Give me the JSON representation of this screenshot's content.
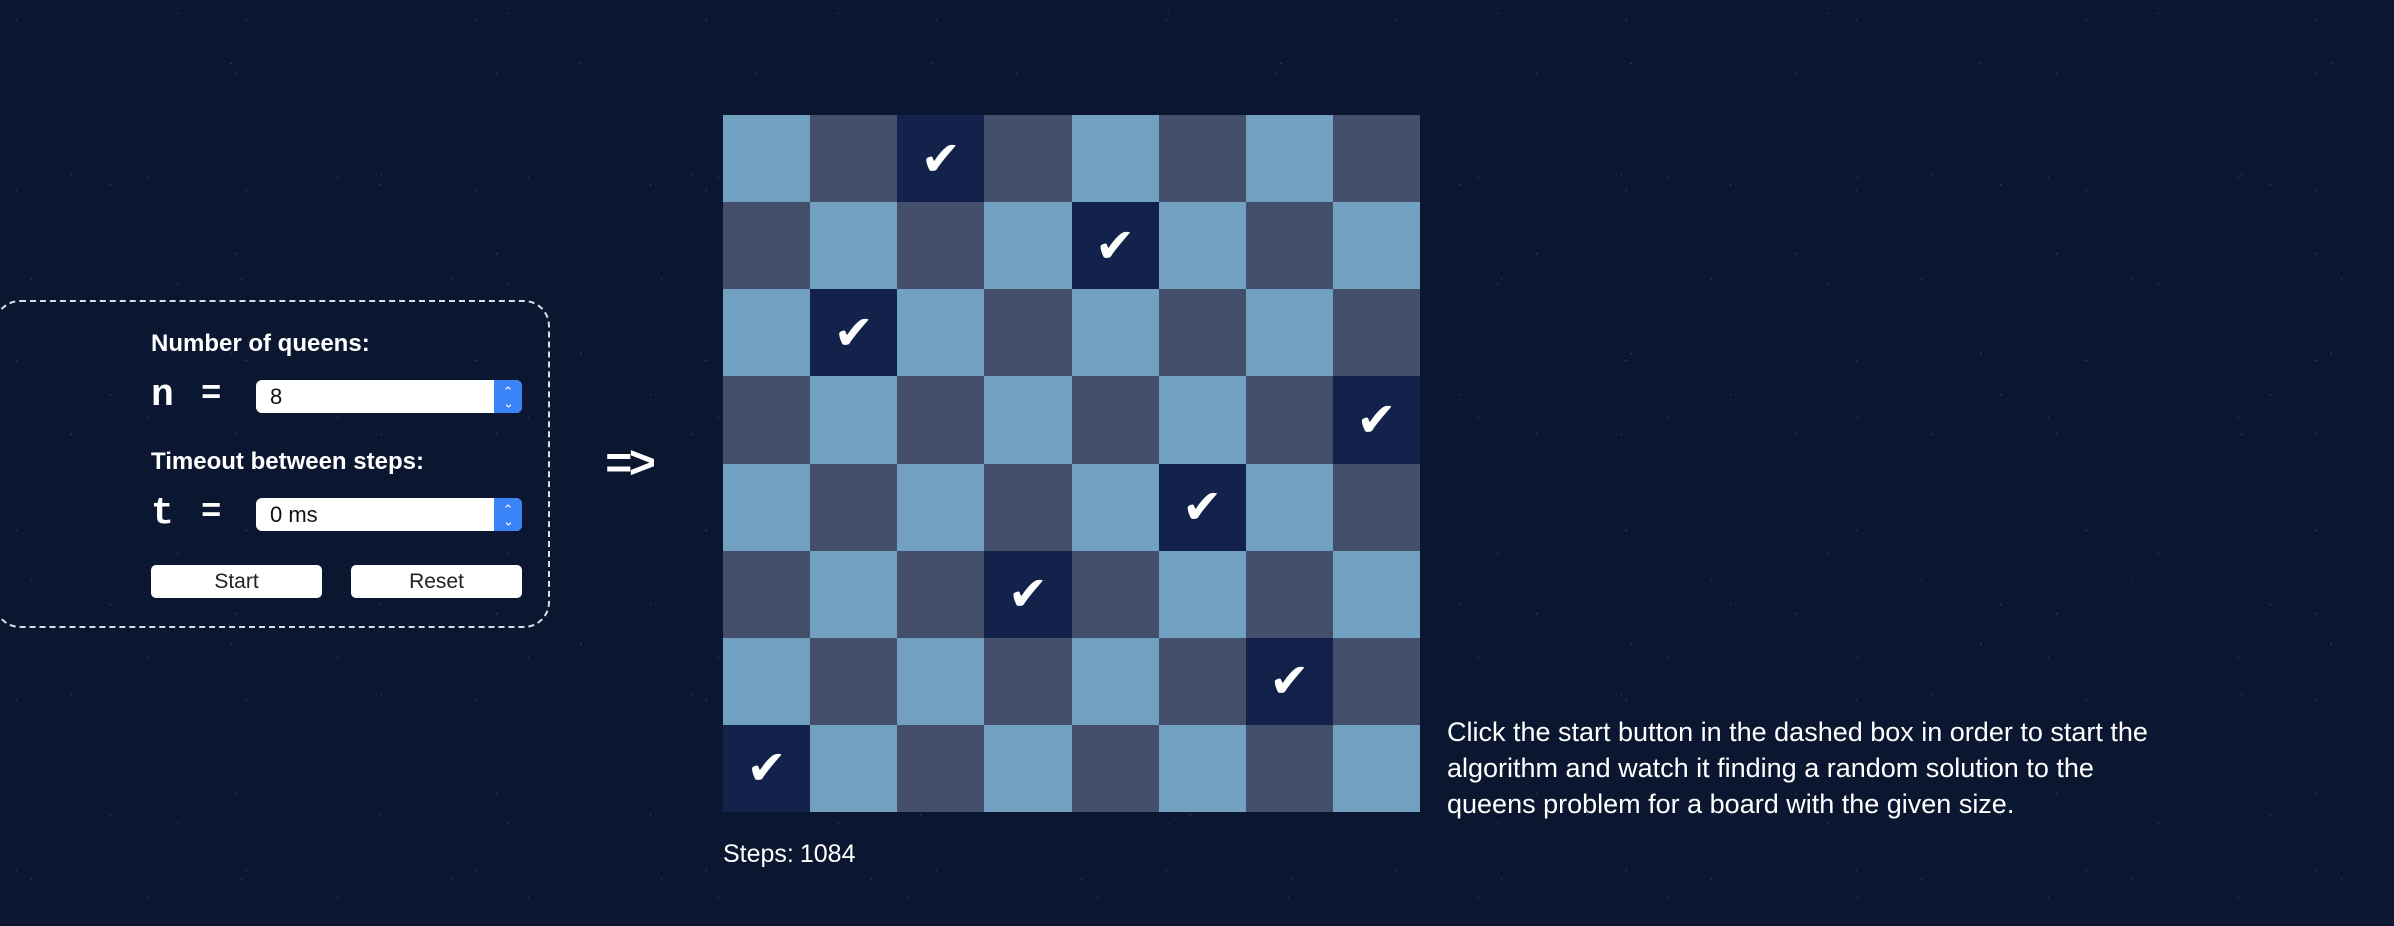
{
  "controls": {
    "queens_label": "Number of queens:",
    "n_var": "n",
    "n_equals": "=",
    "n_value": "8",
    "timeout_label": "Timeout between steps:",
    "t_var": "t",
    "t_equals": "=",
    "t_value": "0 ms",
    "start_label": "Start",
    "reset_label": "Reset"
  },
  "arrow": "=>",
  "board": {
    "size": 8,
    "queen_symbol": "✔",
    "queen_columns_by_row": [
      2,
      4,
      1,
      7,
      5,
      3,
      6,
      0
    ],
    "colors": {
      "light": "#71a0c1",
      "dark": "#424e6a",
      "queen": "#13224a"
    }
  },
  "status": {
    "steps_label": "Steps:",
    "steps_value": "1084"
  },
  "description": "Click the start button in the dashed box in order to start the algorithm and watch it finding a random solution to the queens problem for a board with the given size."
}
